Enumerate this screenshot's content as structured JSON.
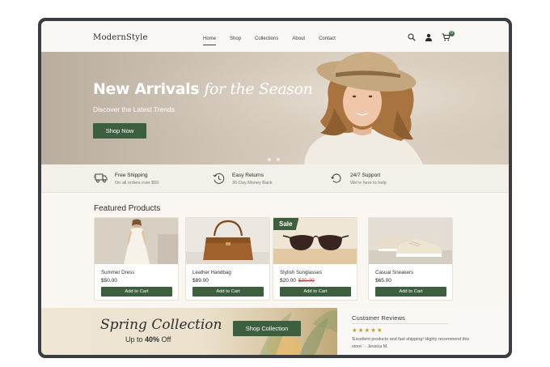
{
  "brand": "ModernStyle",
  "nav": [
    "Home",
    "Shop",
    "Collections",
    "About",
    "Contact"
  ],
  "cart_count": "0",
  "hero": {
    "title_main": "New Arrivals ",
    "title_emph": "for the Season",
    "subtitle": "Discover the Latest Trends",
    "cta": "Shop Now"
  },
  "features": [
    {
      "title": "Free Shipping",
      "sub": "On all orders over $50",
      "icon": "truck-icon"
    },
    {
      "title": "Easy Returns",
      "sub": "30-Day Money Back",
      "icon": "clock-return-icon"
    },
    {
      "title": "24/7 Support",
      "sub": "We're here to help",
      "icon": "support-icon"
    }
  ],
  "featured_title": "Featured Products",
  "products": [
    {
      "name": "Summer Dress",
      "price": "$50.00",
      "old_price": "",
      "button": "Add to Cart"
    },
    {
      "name": "Leather Handbag",
      "price": "$89.00",
      "old_price": "",
      "button": "Add to Cart"
    },
    {
      "name": "Stylish Sunglasses",
      "price": "$20.00",
      "old_price": "$30.00",
      "button": "Add to Cart",
      "badge": "Sale"
    },
    {
      "name": "Casual Sneakers",
      "price": "$65.00",
      "old_price": "",
      "button": "Add to Cart"
    }
  ],
  "spring": {
    "title": "Spring Collection",
    "sub_prefix": "Up to ",
    "sub_bold": "40%",
    "sub_suffix": " Off",
    "cta": "Shop Collection"
  },
  "reviews": {
    "title": "Customer Reviews",
    "stars": "★★★★★",
    "quote": "'Excellent products and fast shipping! Highly recommend this store.'  - Jessica M."
  },
  "colors": {
    "accent": "#3d5f3f",
    "sale_price": "#b0443e",
    "star": "#c89b2f"
  }
}
